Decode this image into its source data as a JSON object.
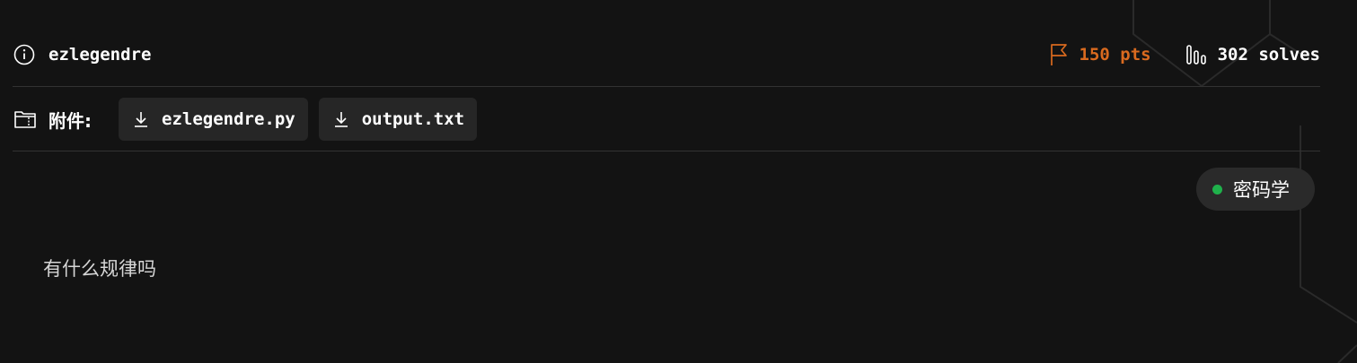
{
  "challenge": {
    "title": "ezlegendre",
    "points": "150 pts",
    "solves": "302 solves",
    "attachments_label": "附件:",
    "attachments": [
      {
        "name": "ezlegendre.py",
        "icon": "download-icon"
      },
      {
        "name": "output.txt",
        "icon": "download-icon"
      }
    ],
    "category": "密码学",
    "description": "有什么规律吗"
  },
  "colors": {
    "background": "#131313",
    "points": "#d96a1f",
    "category_dot": "#1fb14b",
    "button_bg": "#262626"
  },
  "icons": {
    "title": "info-icon",
    "points": "flag-icon",
    "solves": "bar-chart-icon",
    "attachments": "folder-icon"
  }
}
